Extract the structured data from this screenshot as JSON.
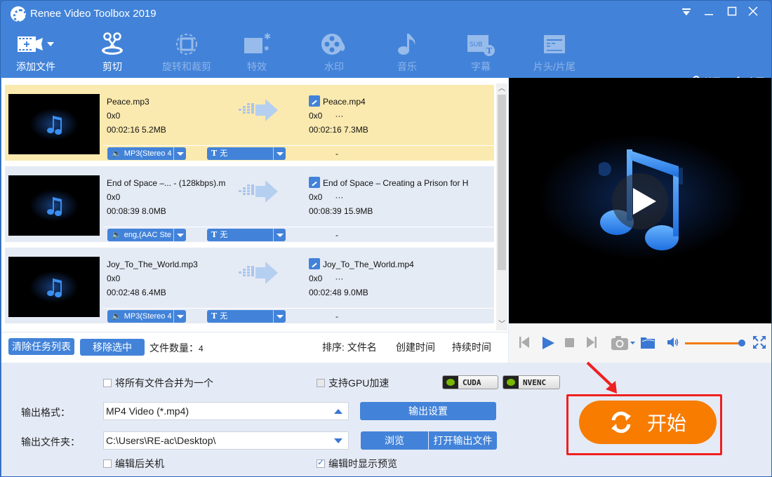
{
  "window": {
    "title": "Renee Video Toolbox 2019",
    "controls": [
      "menu",
      "minimize",
      "maximize",
      "close"
    ]
  },
  "toolbar": {
    "items": [
      {
        "label": "添加文件",
        "icon": "add-file-icon",
        "enabled": true
      },
      {
        "label": "剪切",
        "icon": "scissors-icon",
        "enabled": true
      },
      {
        "label": "旋转和裁剪",
        "icon": "rotate-crop-icon",
        "enabled": false
      },
      {
        "label": "特效",
        "icon": "effects-icon",
        "enabled": false
      },
      {
        "label": "水印",
        "icon": "watermark-icon",
        "enabled": false
      },
      {
        "label": "音乐",
        "icon": "music-icon",
        "enabled": false
      },
      {
        "label": "字幕",
        "icon": "subtitle-icon",
        "enabled": false
      },
      {
        "label": "片头/片尾",
        "icon": "intro-outro-icon",
        "enabled": false
      }
    ],
    "about_label": "关于",
    "home_label": "主页"
  },
  "files": [
    {
      "source_name": "Peace.mp3",
      "source_resolution": "0x0",
      "source_duration_size": "00:02:16  5.2MB",
      "output_name": "Peace.mp4",
      "output_resolution": "0x0",
      "output_extra": "···",
      "output_duration_size": "00:02:16  7.3MB",
      "audio_track": "MP3(Stereo 4",
      "subtitle": "无",
      "dash": "-",
      "selected": true
    },
    {
      "source_name": "End of Space –... - (128kbps).m",
      "source_resolution": "0x0",
      "source_duration_size": "00:08:39  8.0MB",
      "output_name": "End of Space – Creating a Prison for H",
      "output_resolution": "0x0",
      "output_extra": "···",
      "output_duration_size": "00:08:39  15.9MB",
      "audio_track": "eng,(AAC Ste",
      "subtitle": "无",
      "dash": "-",
      "selected": false
    },
    {
      "source_name": "Joy_To_The_World.mp3",
      "source_resolution": "0x0",
      "source_duration_size": "00:02:48  6.4MB",
      "output_name": "Joy_To_The_World.mp4",
      "output_resolution": "0x0",
      "output_extra": "···",
      "output_duration_size": "00:02:48  9.0MB",
      "audio_track": "MP3(Stereo 4",
      "subtitle": "无",
      "dash": "-",
      "selected": false
    }
  ],
  "list_footer": {
    "clear_label": "清除任务列表",
    "remove_label": "移除选中",
    "file_count_label": "文件数量：",
    "file_count": "4",
    "sort_label": "排序: 文件名",
    "sort_created": "创建时间",
    "sort_duration": "持续时间"
  },
  "player": {
    "volume_percent": 100
  },
  "settings": {
    "merge_label": "将所有文件合并为一个",
    "merge_checked": false,
    "gpu_label": "支持GPU加速",
    "gpu_checked": false,
    "cuda_label": "CUDA",
    "nvenc_label": "NVENC",
    "output_format_label": "输出格式：",
    "output_format_value": "MP4 Video (*.mp4)",
    "output_settings_label": "输出设置",
    "output_folder_label": "输出文件夹：",
    "output_folder_value": "C:\\Users\\RE-ac\\Desktop\\",
    "browse_label": "浏览",
    "open_output_label": "打开输出文件",
    "shutdown_label": "编辑后关机",
    "shutdown_checked": false,
    "preview_label": "编辑时显示预览",
    "preview_checked": true
  },
  "start_button": {
    "label": "开始"
  },
  "colors": {
    "brand_blue": "#4283d9",
    "selected_row": "#fbeaaf",
    "start_orange": "#f77c00",
    "annotation_red": "#ef2020"
  }
}
